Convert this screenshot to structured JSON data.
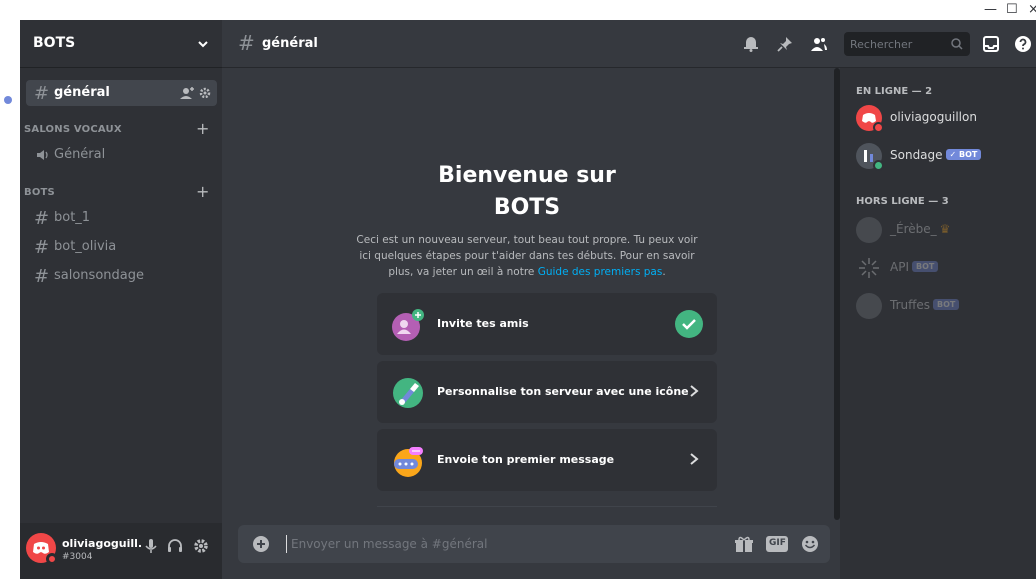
{
  "window": {
    "minimize": "—",
    "maximize": "☐",
    "close": "×"
  },
  "server": {
    "name": "BOTS"
  },
  "sidebar": {
    "channels_top": [
      {
        "label": "général",
        "active": true
      }
    ],
    "voice_category": "SALONS VOCAUX",
    "voice_channels": [
      {
        "label": "Général"
      }
    ],
    "bots_category": "BOTS",
    "bots_channels": [
      {
        "label": "bot_1"
      },
      {
        "label": "bot_olivia"
      },
      {
        "label": "salonsondage"
      }
    ]
  },
  "user": {
    "name": "oliviagoguill...",
    "tag": "#3004"
  },
  "header": {
    "hash": "#",
    "channel": "général",
    "search_placeholder": "Rechercher"
  },
  "welcome": {
    "title_line1": "Bienvenue sur",
    "title_line2": "BOTS",
    "text": "Ceci est un nouveau serveur, tout beau tout propre. Tu peux voir ici quelques étapes pour t'aider dans tes débuts. Pour en savoir plus, va jeter un œil à notre ",
    "link": "Guide des premiers pas",
    "text_end": ".",
    "cards": [
      {
        "label": "Invite tes amis",
        "done": true
      },
      {
        "label": "Personnalise ton serveur avec une icône",
        "done": false
      },
      {
        "label": "Envoie ton premier message",
        "done": false
      }
    ]
  },
  "composer": {
    "placeholder": "Envoyer un message à #général",
    "gif_label": "GIF"
  },
  "members": {
    "online_header": "EN LIGNE — 2",
    "online": [
      {
        "name": "oliviagoguillon",
        "bot": false
      },
      {
        "name": "Sondage",
        "bot": true,
        "bot_label": "✓ BOT"
      }
    ],
    "offline_header": "HORS LIGNE — 3",
    "offline": [
      {
        "name": "_Érèbe_",
        "bot": false
      },
      {
        "name": "API",
        "bot": true,
        "bot_label": "BOT"
      },
      {
        "name": "Truffes",
        "bot": true,
        "bot_label": "BOT"
      }
    ]
  },
  "colors": {
    "accent": "#7289da",
    "online": "#43b581",
    "dnd": "#f04747",
    "link": "#00aff4"
  }
}
